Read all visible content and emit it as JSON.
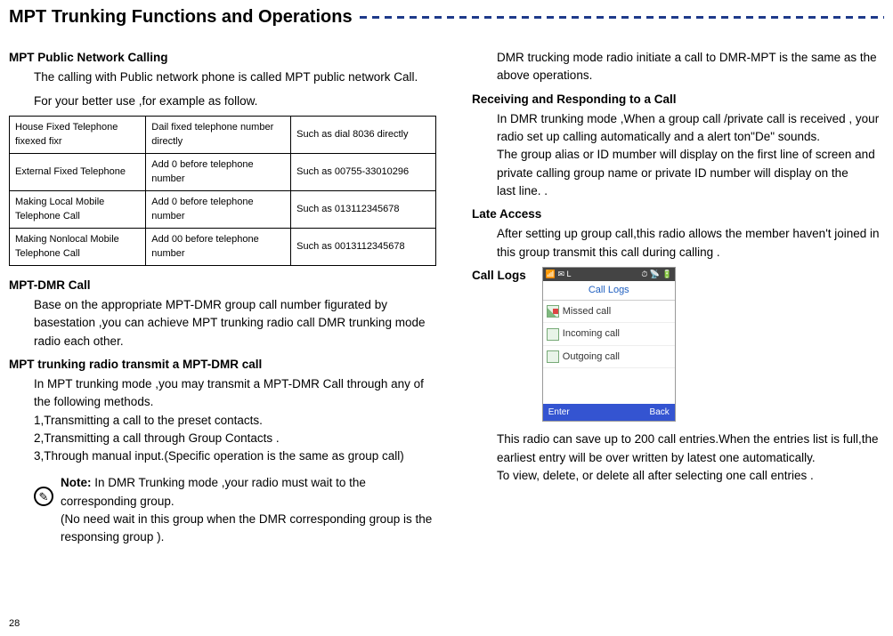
{
  "page_title": "MPT Trunking Functions and Operations",
  "page_number": "28",
  "left": {
    "sec1_title": "MPT Public Network Calling",
    "sec1_p1": "The calling with Public network phone is called MPT public network Call.",
    "sec1_p2": "For your better use ,for example as follow.",
    "table": [
      {
        "c1": "House Fixed Telephone  fixexed  fixr",
        "c2": "Dail fixed telephone number directly",
        "c3": "Such as  dial 8036 directly"
      },
      {
        "c1": "External Fixed Telephone",
        "c2": " Add  0 before telephone number",
        "c3": "Such as 00755-33010296"
      },
      {
        "c1": "Making Local Mobile Telephone Call",
        "c2": "Add 0 before telephone number",
        "c3": "Such as 013112345678"
      },
      {
        "c1": "Making Nonlocal Mobile Telephone Call",
        "c2": "Add 00 before telephone number",
        "c3": "Such as 0013112345678"
      }
    ],
    "sec2_title": "MPT-DMR Call",
    "sec2_p1": "Base on the appropriate MPT-DMR   group call number figurated by basestation ,you can achieve MPT trunking radio call DMR trunking mode radio each other.",
    "sec3_title": "MPT trunking radio transmit a MPT-DMR call",
    "sec3_p1": "In MPT trunking mode ,you may transmit a MPT-DMR Call through any of the following methods.",
    "sec3_l1": "1,Transmitting a call to the preset contacts.",
    "sec3_l2": "2,Transmitting a call through Group Contacts .",
    "sec3_l3": "3,Through manual input.(Specific operation is the same as group call)",
    "note_label": "Note:",
    "note_body": " In DMR Trunking mode ,your radio must wait  to the corresponding group.",
    "note_body2": "(No need wait in this group when the DMR corresponding group is the responsing group )."
  },
  "right": {
    "p0": "DMR trucking mode radio initiate a call to DMR-MPT is the same as the above operations.",
    "sec1_title": "Receiving and Responding to a Call",
    "sec1_p1": "In DMR trunking mode ,When a group call /private call is received , your radio set up calling automatically and a alert ton\"De\" sounds.",
    "sec1_p2": "The group alias or ID mumber will display on the first line of screen and private calling group name or private ID number will display on the",
    "sec1_p3": "last line.  .",
    "sec2_title": "Late Access",
    "sec2_p1": "After setting up group call,this radio allows the member haven't joined in this group transmit this call during calling .",
    "sec3_title": "Call Logs",
    "phone": {
      "status_left": "📶 ✉ L",
      "status_right": "⏱ 📡 🔋",
      "title": "Call Logs",
      "items": [
        "Missed call",
        "Incoming call",
        "Outgoing call"
      ],
      "footer_left": "Enter",
      "footer_right": "Back"
    },
    "sec3_p1": "This radio can save up to 200 call entries.When the entries list is full,the earliest entry will be over written by latest one automatically.",
    "sec3_p2": "To view, delete, or delete all after selecting one call entries ."
  }
}
